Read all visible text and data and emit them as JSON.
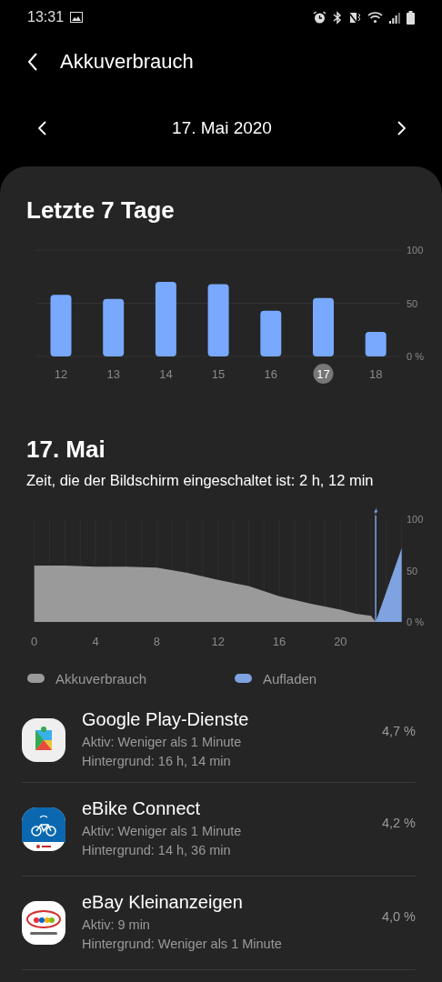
{
  "status_bar": {
    "time": "13:31"
  },
  "header": {
    "title": "Akkuverbrauch"
  },
  "date_nav": {
    "date": "17. Mai 2020"
  },
  "week": {
    "title": "Letzte 7 Tage",
    "chart_data": {
      "type": "bar",
      "categories": [
        "12",
        "13",
        "14",
        "15",
        "16",
        "17",
        "18"
      ],
      "series": [
        {
          "color": "#78a9ff",
          "values": [
            58,
            54,
            70,
            68,
            43,
            55,
            23
          ]
        }
      ],
      "ylim": [
        0,
        100
      ],
      "yticks": [
        {
          "value": 0,
          "label": "0 %"
        },
        50,
        100
      ],
      "grid": true
    },
    "days": [
      {
        "selected": false
      },
      {
        "selected": false
      },
      {
        "selected": false
      },
      {
        "selected": false
      },
      {
        "selected": false
      },
      {
        "selected": true
      },
      {
        "selected": false
      }
    ]
  },
  "day": {
    "title": "17. Mai",
    "screen_time": "Zeit, die der Bildschirm eingeschaltet ist: 2 h, 12 min",
    "chart_data": {
      "type": "area",
      "x": [
        0,
        2,
        4,
        6,
        8,
        10,
        12,
        14,
        16,
        18,
        20,
        21,
        22,
        22.3,
        24
      ],
      "series": [
        {
          "name": "Akkuverbrauch",
          "color": "#9a9a9a",
          "values": [
            55,
            55,
            54,
            54,
            53,
            48,
            41,
            35,
            25,
            18,
            12,
            8,
            6,
            0,
            null
          ]
        },
        {
          "name": "Aufladen",
          "color": "#7fa3e0",
          "values": [
            null,
            null,
            null,
            null,
            null,
            null,
            null,
            null,
            null,
            null,
            null,
            null,
            null,
            0,
            72
          ]
        }
      ],
      "xlim": [
        0,
        24
      ],
      "ylim": [
        0,
        100
      ],
      "xticks": [
        0,
        4,
        8,
        12,
        16,
        20
      ],
      "yticks": [
        {
          "value": 0,
          "label": "0 %"
        },
        50,
        100
      ],
      "grid": true,
      "ref_lines": [
        {
          "axis": "x",
          "value": 22.3
        }
      ]
    }
  },
  "apps": [
    {
      "kind": "play",
      "name": "Google Play-Dienste",
      "active": "Aktiv: Weniger als 1 Minute",
      "background": "Hintergrund: 16 h, 14 min",
      "share": "4,7 %"
    },
    {
      "kind": "ebike",
      "name": "eBike Connect",
      "active": "Aktiv: Weniger als 1 Minute",
      "background": "Hintergrund: 14 h, 36 min",
      "share": "4,2 %"
    },
    {
      "kind": "ebay",
      "name": "eBay Kleinanzeigen",
      "active": "Aktiv: 9 min",
      "background": "Hintergrund: Weniger als 1 Minute",
      "share": "4,0 %"
    }
  ]
}
